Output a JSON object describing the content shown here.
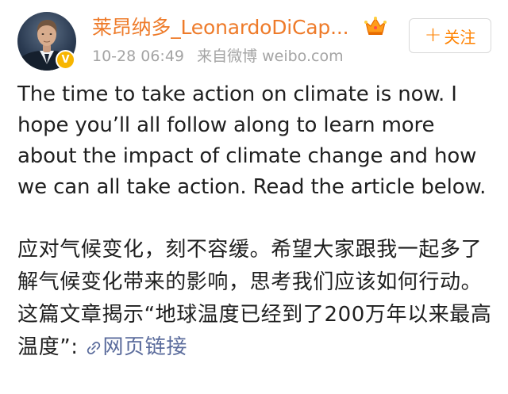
{
  "header": {
    "user_name": "莱昂纳多_LeonardoDiCap...",
    "timestamp": "10-28 06:49",
    "source": "来自微博 weibo.com",
    "follow_label": "关注",
    "follow_plus": "+",
    "verified_badge": "V",
    "avatar_icon": "user-avatar-icon",
    "crown_icon": "crown-icon"
  },
  "post": {
    "text_en": "The time to take action on climate is now. I hope you’ll all follow along to learn more about the impact of climate change and how we can all take action. Read the article below.",
    "text_zh": "应对气候变化，刻不容缓。希望大家跟我一起多了解气候变化带来的影响，思考我们应该如何行动。这篇文章揭示“地球温度已经到了200万年以来最高温度”:",
    "link_label": "网页链接",
    "link_icon": "link-icon"
  },
  "colors": {
    "name": "#ee7b2a",
    "meta": "#a4a4a4",
    "follow": "#ff8200",
    "link": "#5b6c9c",
    "badge": "#f7b500",
    "body_text": "#1f1f1f"
  }
}
